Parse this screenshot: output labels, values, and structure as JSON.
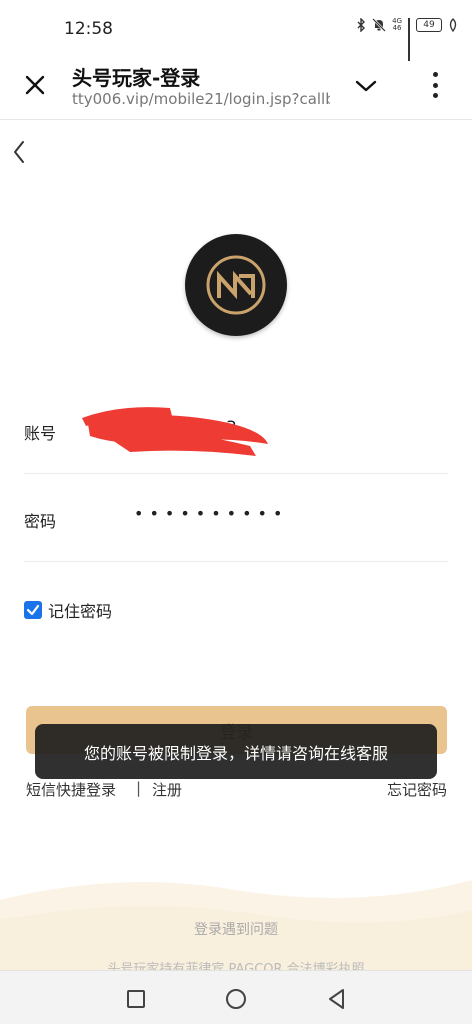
{
  "status_bar": {
    "time": "12:58",
    "network_top": "4G",
    "network_bottom": "46",
    "battery": "49",
    "icons": [
      "bluetooth-icon",
      "mute-bell-icon",
      "signal-icon",
      "battery-icon",
      "leaf-icon"
    ]
  },
  "browser": {
    "title": "头号玩家-登录",
    "url": "tty006.vip/mobile21/login.jsp?callb",
    "icons": [
      "close-icon",
      "chevron-down-icon",
      "more-vertical-icon"
    ]
  },
  "login": {
    "account_label": "账号",
    "account_visible_suffix": "3",
    "password_label": "密码",
    "password_masked": "••••••••••",
    "remember_checked": true,
    "remember_label": "记住密码",
    "login_button": "登录",
    "toast": "您的账号被限制登录，详情请咨询在线客服",
    "sms_login": "短信快捷登录",
    "separator": "|",
    "register": "注册",
    "forgot_password": "忘记密码"
  },
  "footer": {
    "help": "登录遇到问题",
    "license": "头号玩家持有菲律宾 PAGCOR 合法博彩执照"
  },
  "colors": {
    "accent_gold": "#e9c48f",
    "checkbox_blue": "#1a73e8",
    "toast_bg": "#1e1e1e",
    "redaction_red": "#ee3b33"
  }
}
